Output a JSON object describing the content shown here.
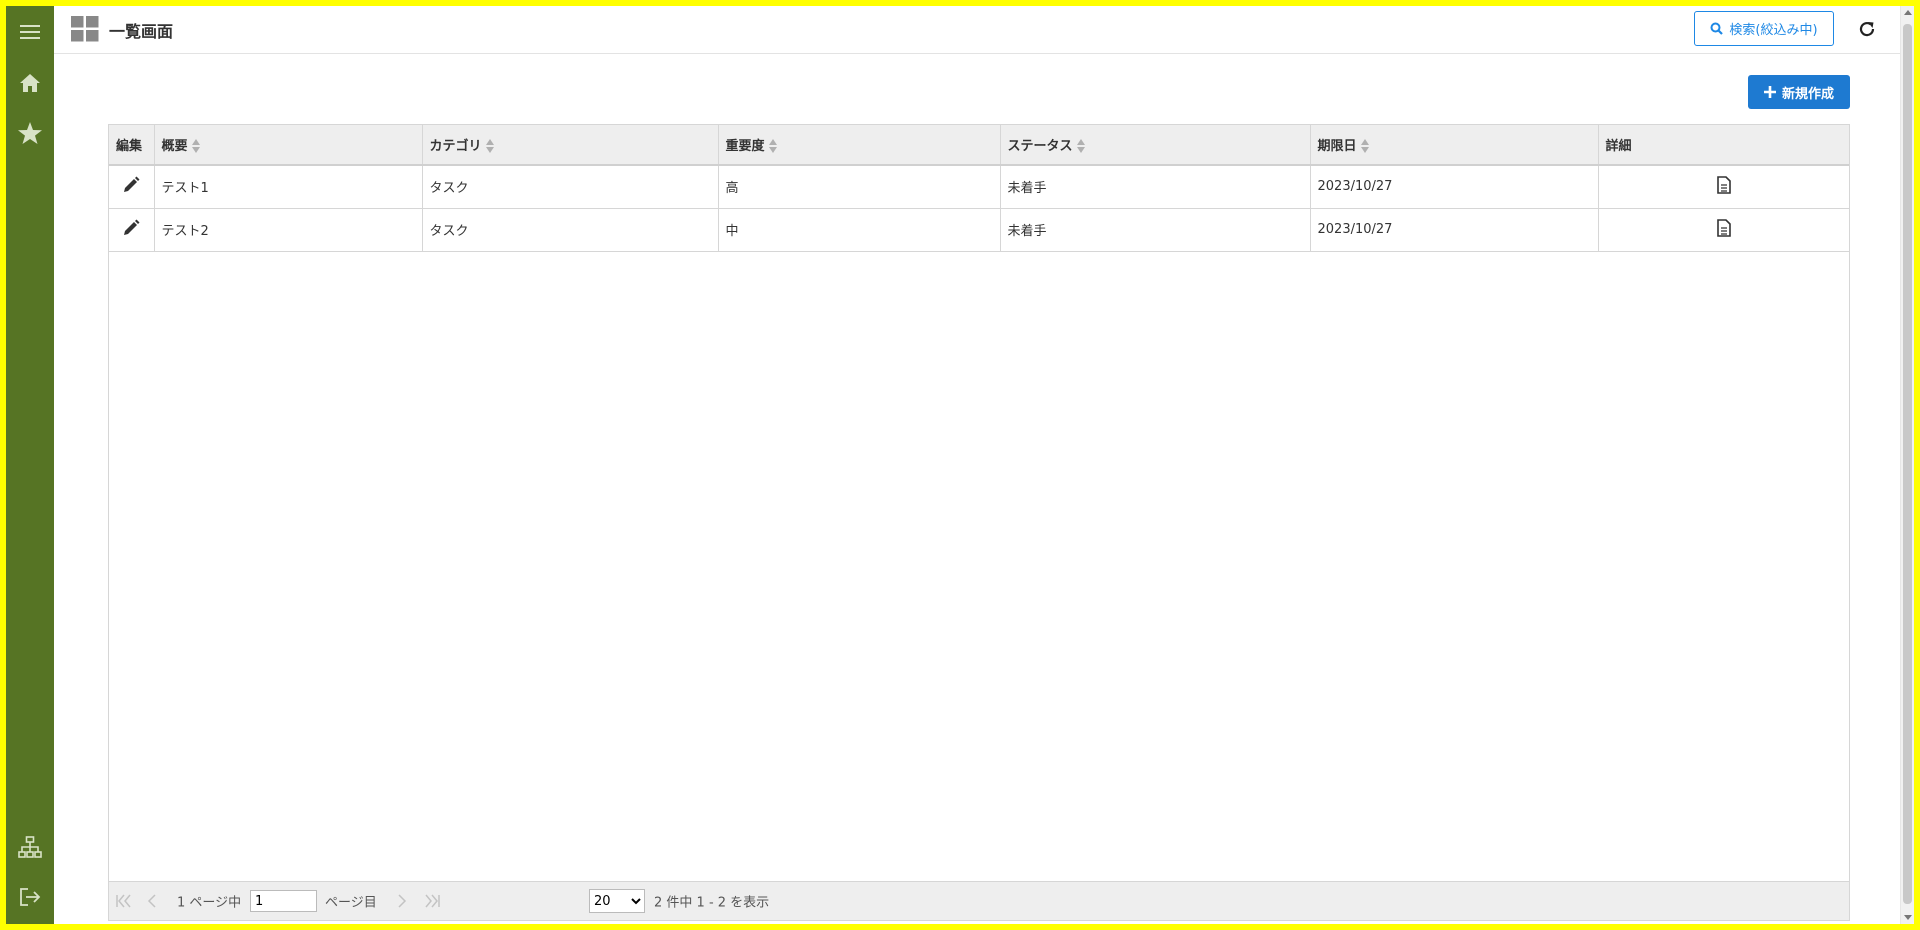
{
  "header": {
    "title": "一覧画面",
    "search_label": "検索(絞込み中)"
  },
  "sidebar": {
    "items": [
      {
        "icon": "hamburger-icon"
      },
      {
        "icon": "home-icon"
      },
      {
        "icon": "star-icon"
      },
      {
        "icon": "sitemap-icon"
      },
      {
        "icon": "logout-icon"
      }
    ]
  },
  "toolbar": {
    "new_label": "新規作成"
  },
  "table": {
    "columns": [
      "編集",
      "概要",
      "カテゴリ",
      "重要度",
      "ステータス",
      "期限日",
      "詳細"
    ],
    "rows": [
      {
        "summary": "テスト1",
        "category": "タスク",
        "priority": "高",
        "status": "未着手",
        "due": "2023/10/27"
      },
      {
        "summary": "テスト2",
        "category": "タスク",
        "priority": "中",
        "status": "未着手",
        "due": "2023/10/27"
      }
    ]
  },
  "pager": {
    "page_total_text": "1 ページ中",
    "page_value": "1",
    "page_suffix": "ページ目",
    "per_page": "20",
    "summary": "2 件中 1 - 2 を表示"
  },
  "colors": {
    "sidebar": "#567424",
    "accent": "#1e7ad1",
    "frame": "#ffff00"
  }
}
